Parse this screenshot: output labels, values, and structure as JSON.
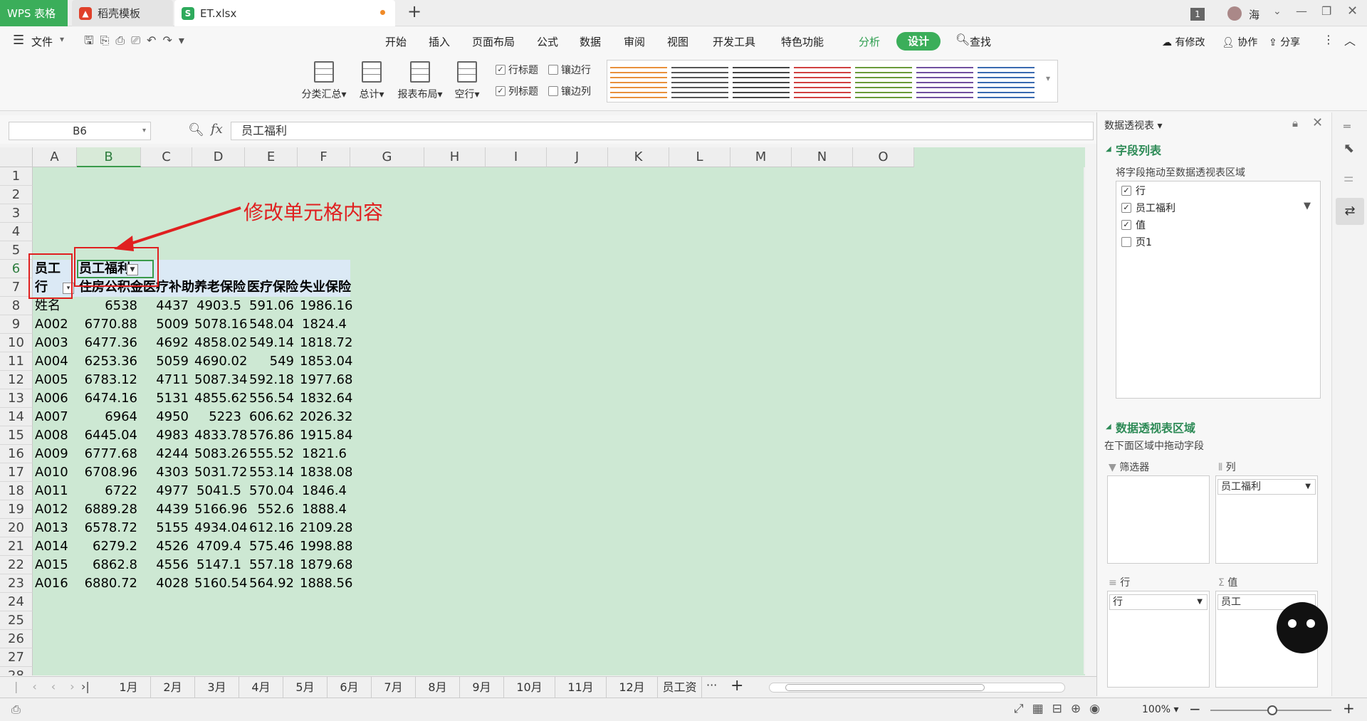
{
  "titlebar": {
    "tab_wps": "WPS 表格",
    "tab_daoke": "稻壳模板",
    "tab_et": "ET.xlsx",
    "new_tab": "+",
    "badge": "1",
    "user": "海"
  },
  "menu": {
    "file": "文件",
    "items": [
      "开始",
      "插入",
      "页面布局",
      "公式",
      "数据",
      "审阅",
      "视图",
      "开发工具",
      "特色功能",
      "分析"
    ],
    "design": "设计",
    "search": "查找",
    "modified": "有修改",
    "collab": "协作",
    "share": "分享"
  },
  "ribbon": {
    "buttons": [
      "分类汇总",
      "总计",
      "报表布局",
      "空行"
    ],
    "checks": [
      {
        "label": "行标题",
        "checked": true
      },
      {
        "label": "镶边行",
        "checked": false
      },
      {
        "label": "列标题",
        "checked": true
      },
      {
        "label": "镶边列",
        "checked": false
      }
    ],
    "style_colors": [
      "#e8903c",
      "#555555",
      "#444444",
      "#d04040",
      "#6a9a3a",
      "#7050a0",
      "#3a6ab0"
    ]
  },
  "formula": {
    "cell_ref": "B6",
    "fx": "fx",
    "value": "员工福利"
  },
  "annotation": "修改单元格内容",
  "columns": [
    "A",
    "B",
    "C",
    "D",
    "E",
    "F",
    "G",
    "H",
    "I",
    "J",
    "K",
    "L",
    "M",
    "N",
    "O"
  ],
  "rows": [
    "1",
    "2",
    "3",
    "4",
    "5",
    "6",
    "7",
    "8",
    "9",
    "10",
    "11",
    "12",
    "13",
    "14",
    "15",
    "16",
    "17",
    "18",
    "19",
    "20",
    "21",
    "22",
    "23",
    "24",
    "25",
    "26",
    "27",
    "28"
  ],
  "pivot": {
    "r6": [
      "员工",
      "员工福利"
    ],
    "r7": [
      "行",
      "住房公积金",
      "医疗补助",
      "养老保险",
      "医疗保险",
      "失业保险"
    ],
    "data": [
      [
        "姓名",
        "6538",
        "4437",
        "4903.5",
        "591.06",
        "1986.16"
      ],
      [
        "A002",
        "6770.88",
        "5009",
        "5078.16",
        "548.04",
        "1824.4"
      ],
      [
        "A003",
        "6477.36",
        "4692",
        "4858.02",
        "549.14",
        "1818.72"
      ],
      [
        "A004",
        "6253.36",
        "5059",
        "4690.02",
        "549",
        "1853.04"
      ],
      [
        "A005",
        "6783.12",
        "4711",
        "5087.34",
        "592.18",
        "1977.68"
      ],
      [
        "A006",
        "6474.16",
        "5131",
        "4855.62",
        "556.54",
        "1832.64"
      ],
      [
        "A007",
        "6964",
        "4950",
        "5223",
        "606.62",
        "2026.32"
      ],
      [
        "A008",
        "6445.04",
        "4983",
        "4833.78",
        "576.86",
        "1915.84"
      ],
      [
        "A009",
        "6777.68",
        "4244",
        "5083.26",
        "555.52",
        "1821.6"
      ],
      [
        "A010",
        "6708.96",
        "4303",
        "5031.72",
        "553.14",
        "1838.08"
      ],
      [
        "A011",
        "6722",
        "4977",
        "5041.5",
        "570.04",
        "1846.4"
      ],
      [
        "A012",
        "6889.28",
        "4439",
        "5166.96",
        "552.6",
        "1888.4"
      ],
      [
        "A013",
        "6578.72",
        "5155",
        "4934.04",
        "612.16",
        "2109.28"
      ],
      [
        "A014",
        "6279.2",
        "4526",
        "4709.4",
        "575.46",
        "1998.88"
      ],
      [
        "A015",
        "6862.8",
        "4556",
        "5147.1",
        "557.18",
        "1879.68"
      ],
      [
        "A016",
        "6880.72",
        "4028",
        "5160.54",
        "564.92",
        "1888.56"
      ]
    ]
  },
  "sheets": [
    "1月",
    "2月",
    "3月",
    "4月",
    "5月",
    "6月",
    "7月",
    "8月",
    "9月",
    "10月",
    "11月",
    "12月",
    "员工资料"
  ],
  "sheet_more": "···",
  "status": {
    "zoom": "100%"
  },
  "panel": {
    "title": "数据透视表",
    "field_list": "字段列表",
    "field_hint": "将字段拖动至数据透视表区域",
    "fields": [
      {
        "label": "行",
        "checked": true
      },
      {
        "label": "员工福利",
        "checked": true
      },
      {
        "label": "值",
        "checked": true
      },
      {
        "label": "页1",
        "checked": false
      }
    ],
    "areas_title": "数据透视表区域",
    "areas_hint": "在下面区域中拖动字段",
    "filter": "筛选器",
    "column": "列",
    "column_value": "员工福利",
    "row": "行",
    "row_value": "行",
    "values": "值",
    "values_value": "员工"
  }
}
